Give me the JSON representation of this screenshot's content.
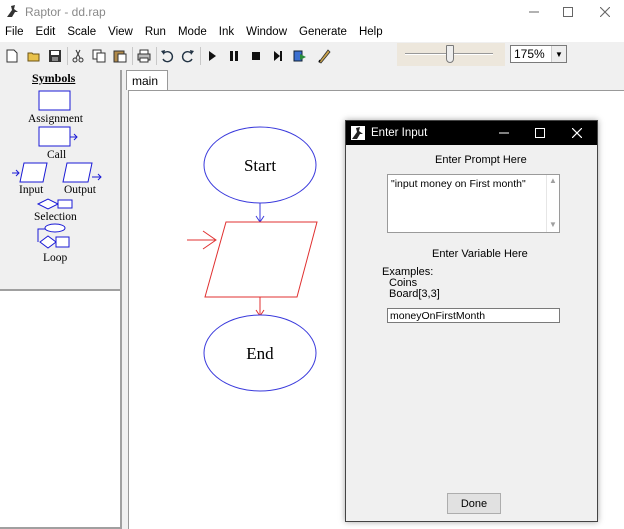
{
  "window": {
    "title": "Raptor - dd.rap",
    "controls": [
      "minimize-icon",
      "maximize-icon",
      "close-icon"
    ]
  },
  "menu": {
    "items": [
      "File",
      "Edit",
      "Scale",
      "View",
      "Run",
      "Mode",
      "Ink",
      "Window",
      "Generate",
      "Help"
    ]
  },
  "toolbar": {
    "buttons": [
      "new-file-icon",
      "open-folder-icon",
      "save-icon",
      "cut-icon",
      "copy-icon",
      "paste-icon",
      "print-icon",
      "undo-icon",
      "redo-icon",
      "play-icon",
      "pause-icon",
      "stop-icon",
      "step-icon",
      "test-server-icon",
      "pen-icon"
    ],
    "zoom": "175%"
  },
  "symbols_panel": {
    "title": "Symbols",
    "items": [
      "Assignment",
      "Call",
      "Input",
      "Output",
      "Selection",
      "Loop"
    ]
  },
  "tabs": [
    "main"
  ],
  "flowchart": {
    "start_label": "Start",
    "end_label": "End",
    "colors": {
      "terminal": "#3a3adc",
      "selected": "#e03030",
      "connector": "#e03030"
    }
  },
  "dialog": {
    "title": "Enter Input",
    "prompt_heading": "Enter Prompt Here",
    "prompt_value": "\"input money on First month\"",
    "variable_heading": "Enter Variable Here",
    "examples_label": "Examples:",
    "examples": [
      "Coins",
      "Board[3,3]"
    ],
    "variable_value": "moneyOnFirstMonth",
    "done_label": "Done"
  }
}
